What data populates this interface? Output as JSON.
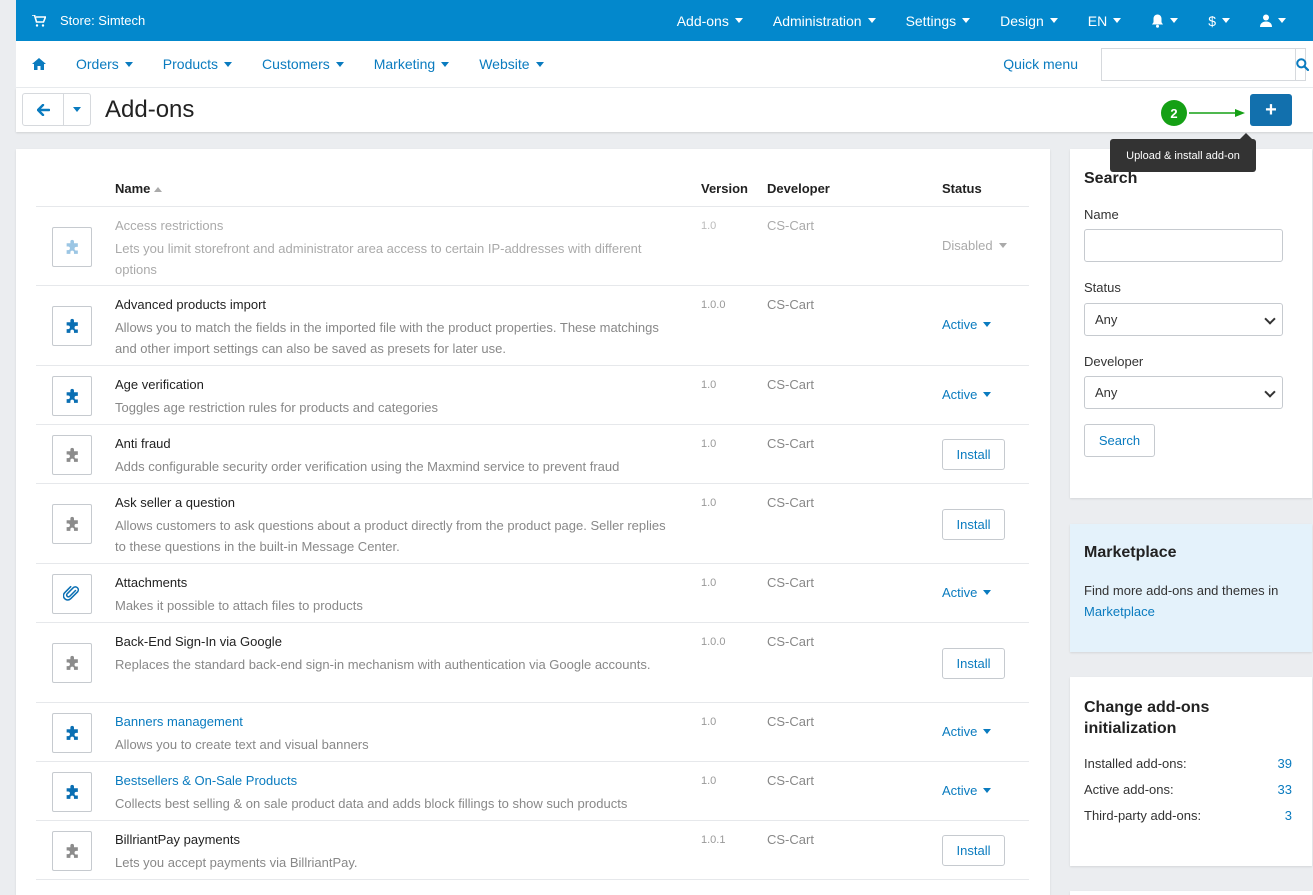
{
  "topbar": {
    "store": "Store: Simtech",
    "menu": [
      "Add-ons",
      "Administration",
      "Settings",
      "Design",
      "EN",
      "$"
    ]
  },
  "nav": {
    "items": [
      "Orders",
      "Products",
      "Customers",
      "Marketing",
      "Website"
    ],
    "quick_menu": "Quick menu",
    "search_placeholder": ""
  },
  "title": "Add-ons",
  "annotation_number": "2",
  "add_button": "+",
  "tooltip": "Upload & install add-on",
  "table": {
    "headers": {
      "name": "Name",
      "version": "Version",
      "developer": "Developer",
      "status": "Status"
    },
    "rows": [
      {
        "name": "Access restrictions",
        "desc": "Lets you limit storefront and administrator area access to certain IP-addresses with different options",
        "version": "1.0",
        "developer": "CS-Cart",
        "status": "Disabled",
        "kind": "disabled",
        "icon": "puzzle-icon"
      },
      {
        "name": "Advanced products import",
        "desc": "Allows you to match the fields in the imported file with the product properties. These matchings and other import settings can also be saved as presets for later use.",
        "version": "1.0.0",
        "developer": "CS-Cart",
        "status": "Active",
        "kind": "active",
        "icon": "puzzle-icon"
      },
      {
        "name": "Age verification",
        "desc": "Toggles age restriction rules for products and categories",
        "version": "1.0",
        "developer": "CS-Cart",
        "status": "Active",
        "kind": "active",
        "icon": "puzzle-icon"
      },
      {
        "name": "Anti fraud",
        "desc": "Adds configurable security order verification using the Maxmind service to prevent fraud",
        "version": "1.0",
        "developer": "CS-Cart",
        "status": "Install",
        "kind": "install",
        "icon": "puzzle-icon"
      },
      {
        "name": "Ask seller a question",
        "desc": "Allows customers to ask questions about a product directly from the product page. Seller replies to these questions in the built-in Message Center.",
        "version": "1.0",
        "developer": "CS-Cart",
        "status": "Install",
        "kind": "install",
        "icon": "puzzle-icon"
      },
      {
        "name": "Attachments",
        "desc": "Makes it possible to attach files to products",
        "version": "1.0",
        "developer": "CS-Cart",
        "status": "Active",
        "kind": "active",
        "icon": "paperclip-icon"
      },
      {
        "name": "Back-End Sign-In via Google",
        "desc": "Replaces the standard back-end sign-in mechanism with authentication via Google accounts.",
        "version": "1.0.0",
        "developer": "CS-Cart",
        "status": "Install",
        "kind": "install",
        "icon": "puzzle-icon"
      },
      {
        "name": "Banners management",
        "desc": "Allows you to create text and visual banners",
        "version": "1.0",
        "developer": "CS-Cart",
        "status": "Active",
        "kind": "active",
        "icon": "puzzle-icon",
        "link": true
      },
      {
        "name": "Bestsellers & On-Sale Products",
        "desc": "Collects best selling & on sale product data and adds block fillings to show such products",
        "version": "1.0",
        "developer": "CS-Cart",
        "status": "Active",
        "kind": "active",
        "icon": "puzzle-icon",
        "link": true
      },
      {
        "name": "BillriantPay payments",
        "desc": "Lets you accept payments via BillriantPay.",
        "version": "1.0.1",
        "developer": "CS-Cart",
        "status": "Install",
        "kind": "install",
        "icon": "puzzle-icon"
      }
    ]
  },
  "sidebar": {
    "search": {
      "title": "Search",
      "name_label": "Name",
      "name_value": "",
      "status_label": "Status",
      "status_value": "Any",
      "developer_label": "Developer",
      "developer_value": "Any",
      "button": "Search"
    },
    "marketplace": {
      "title": "Marketplace",
      "text": "Find more add-ons and themes in ",
      "link": "Marketplace"
    },
    "init": {
      "title": "Change add-ons initialization",
      "stats": [
        {
          "label": "Installed add-ons:",
          "value": "39"
        },
        {
          "label": "Active add-ons:",
          "value": "33"
        },
        {
          "label": "Third-party add-ons:",
          "value": "3"
        }
      ]
    }
  },
  "colors": {
    "topbar": "#0388cc",
    "link": "#0a7bbf",
    "primary_button": "#1270ad",
    "annotation_green": "#15a015",
    "marketplace_bg": "#e4f2fb",
    "icon_active": "#0a6fb3",
    "icon_inactive": "#8c8c8c",
    "icon_disabled": "#9cc6e4"
  }
}
